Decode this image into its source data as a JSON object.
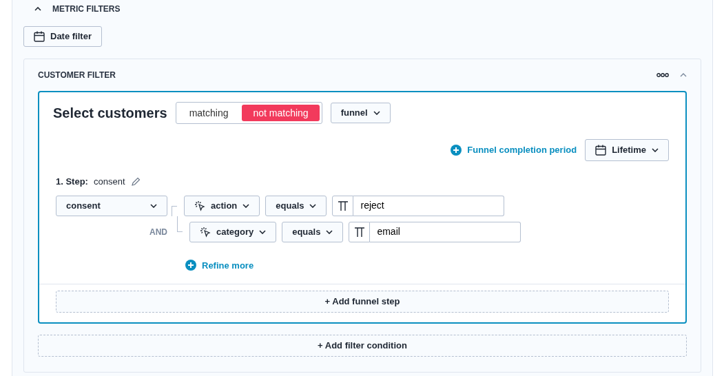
{
  "section": {
    "title": "METRIC FILTERS",
    "expanded": true,
    "date_filter": "Date filter"
  },
  "customer_filter": {
    "title": "CUSTOMER FILTER",
    "expanded": true,
    "heading": "Select customers",
    "match_options": [
      {
        "label": "matching",
        "selected": false
      },
      {
        "label": "not matching",
        "selected": true
      }
    ],
    "type_dropdown": "funnel",
    "completion_link": "Funnel completion period",
    "completion_dropdown": "Lifetime",
    "steps": [
      {
        "label": "1. Step:",
        "name": "consent",
        "event": "consent",
        "conditions": [
          {
            "property": "action",
            "operator": "equals",
            "value": "reject"
          },
          {
            "connector": "AND",
            "property": "category",
            "operator": "equals",
            "value": "email"
          }
        ],
        "refine": "Refine more"
      }
    ],
    "add_step": "+ Add funnel step"
  },
  "add_condition": "+ Add filter condition"
}
